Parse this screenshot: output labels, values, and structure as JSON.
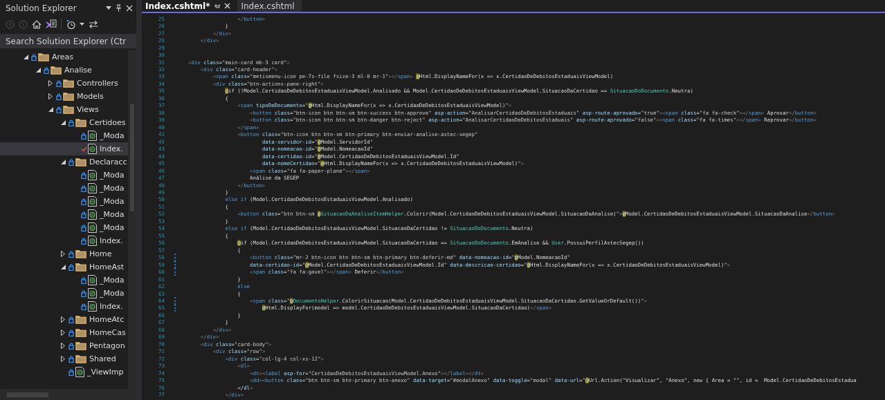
{
  "solution_explorer": {
    "title": "Solution Explorer",
    "search": {
      "placeholder": "Search Solution Explorer (Ctr"
    },
    "tree": [
      {
        "label": "Areas",
        "kind": "folder",
        "expanded": true,
        "selected": false,
        "pending_edit": false,
        "children": [
          {
            "label": "Analise",
            "kind": "folder",
            "expanded": true,
            "selected": false,
            "pending_edit": false,
            "children": [
              {
                "label": "Controllers",
                "kind": "folder",
                "expanded": false,
                "selected": false,
                "pending_edit": false
              },
              {
                "label": "Models",
                "kind": "folder",
                "expanded": false,
                "selected": false,
                "pending_edit": false
              },
              {
                "label": "Views",
                "kind": "folder",
                "expanded": true,
                "selected": false,
                "pending_edit": false,
                "children": [
                  {
                    "label": "Certidoes",
                    "kind": "folder",
                    "expanded": true,
                    "selected": false,
                    "pending_edit": false,
                    "children": [
                      {
                        "label": "_Moda",
                        "kind": "file",
                        "selected": false,
                        "pending_edit": false
                      },
                      {
                        "label": "Index.",
                        "kind": "file",
                        "selected": true,
                        "pending_edit": true
                      }
                    ]
                  },
                  {
                    "label": "Declaracc",
                    "kind": "folder",
                    "expanded": true,
                    "selected": false,
                    "pending_edit": false,
                    "children": [
                      {
                        "label": "_Moda",
                        "kind": "file",
                        "selected": false,
                        "pending_edit": false
                      },
                      {
                        "label": "_Moda",
                        "kind": "file",
                        "selected": false,
                        "pending_edit": false
                      },
                      {
                        "label": "_Moda",
                        "kind": "file",
                        "selected": false,
                        "pending_edit": false
                      },
                      {
                        "label": "_Moda",
                        "kind": "file",
                        "selected": false,
                        "pending_edit": false
                      },
                      {
                        "label": "_Moda",
                        "kind": "file",
                        "selected": false,
                        "pending_edit": false
                      },
                      {
                        "label": "Index.",
                        "kind": "file",
                        "selected": false,
                        "pending_edit": false
                      }
                    ]
                  },
                  {
                    "label": "Home",
                    "kind": "folder",
                    "expanded": false,
                    "selected": false,
                    "pending_edit": false
                  },
                  {
                    "label": "HomeAst",
                    "kind": "folder",
                    "expanded": true,
                    "selected": false,
                    "pending_edit": false,
                    "children": [
                      {
                        "label": "_Moda",
                        "kind": "file",
                        "selected": false,
                        "pending_edit": false
                      },
                      {
                        "label": "_Moda",
                        "kind": "file",
                        "selected": false,
                        "pending_edit": false
                      },
                      {
                        "label": "Index.",
                        "kind": "file",
                        "selected": false,
                        "pending_edit": false
                      }
                    ]
                  },
                  {
                    "label": "HomeAtc",
                    "kind": "folder",
                    "expanded": false,
                    "selected": false,
                    "pending_edit": false
                  },
                  {
                    "label": "HomeCas",
                    "kind": "folder",
                    "expanded": false,
                    "selected": false,
                    "pending_edit": false
                  },
                  {
                    "label": "Pentagon",
                    "kind": "folder",
                    "expanded": false,
                    "selected": false,
                    "pending_edit": false
                  },
                  {
                    "label": "Shared",
                    "kind": "folder",
                    "expanded": false,
                    "selected": false,
                    "pending_edit": false
                  },
                  {
                    "label": "_ViewImp",
                    "kind": "file",
                    "selected": false,
                    "pending_edit": false
                  }
                ]
              }
            ]
          }
        ]
      }
    ]
  },
  "editor": {
    "tabs": [
      {
        "label": "Index.cshtml*",
        "selected": true
      },
      {
        "label": "Index.cshtml",
        "selected": false
      }
    ],
    "lines": [
      {
        "n": "25",
        "text": "                </button>",
        "modified": false
      },
      {
        "n": "26",
        "text": "            }",
        "modified": false
      },
      {
        "n": "27",
        "text": "        </div>",
        "modified": false
      },
      {
        "n": "28",
        "text": "    </div>",
        "modified": false
      },
      {
        "n": "29",
        "modified": false
      },
      {
        "n": "30",
        "modified": false
      },
      {
        "n": "31",
        "text": "<div class=\"main-card mb-3 card\">",
        "modified": false
      },
      {
        "n": "32",
        "text": "    <div class=\"card-header\">",
        "modified": false
      },
      {
        "n": "33",
        "text": "        <span class=\"metismenu-icon pe-7s-file fsize-3 ml-0 mr-1\"></span> @Html.DisplayNameFor(x => x.CertidaoDeDebitosEstaduaisViewModel)",
        "modified": false
      },
      {
        "n": "34",
        "text": "        <div class=\"btn-actions-pane-right\">",
        "modified": false
      },
      {
        "n": "35",
        "text": "            @if (!Model.CertidaoDeDebitosEstaduaisViewModel.Analisado && Model.CertidaoDeDebitosEstaduaisViewModel.SituacaoDaCertidao == SituacaoDoDocumento.Neutra)",
        "modified": false
      },
      {
        "n": "36",
        "text": "            {",
        "modified": false
      },
      {
        "n": "37",
        "text": "                <span tipoDeDocumento=\"@Html.DisplayNameFor(x => x.CertidaoDeDebitosEstaduaisViewModel)\">",
        "modified": false
      },
      {
        "n": "38",
        "text": "                    <button class=\"btn-icon btn btn-sm btn-success btn-approve\" asp-action=\"AnalisarCertidaoDeDebitosEstaduais\" asp-route-aprovado=\"true\"><span class=\"fa fa-check\"></span> Aprovar</button>",
        "modified": false
      },
      {
        "n": "39",
        "text": "                    <button class=\"btn-icon btn btn-sm btn-danger btn-reject\" asp-action=\"AnalisarCertidaoDeDebitosEstaduais\" asp-route-aprovado=\"false\"><span class=\"fa fa-times\"></span> Reprovar</button>",
        "modified": false
      },
      {
        "n": "40",
        "text": "                </span>",
        "modified": false
      },
      {
        "n": "41",
        "text": "                <button class=\"btn-icon btn btn-sm btn-primary btn-enviar-analise-astec-segep\"",
        "modified": false
      },
      {
        "n": "42",
        "text": "                        data-servidor-id=\"@Model.ServidorId\"",
        "modified": false
      },
      {
        "n": "43",
        "text": "                        data-nomeacao-id=\"@Model.NomeacaoId\"",
        "modified": false
      },
      {
        "n": "44",
        "text": "                        data-certidao-id=\"@Model.CertidaoDeDebitosEstaduaisViewModel.Id\"",
        "modified": false
      },
      {
        "n": "45",
        "text": "                        data-nomeCertidao=\"@Html.DisplayNameFor(x => x.CertidaoDeDebitosEstaduaisViewModel)\">",
        "modified": false
      },
      {
        "n": "46",
        "text": "                    <span class=\"fa fa-paper-plane\"></span>",
        "modified": false
      },
      {
        "n": "47",
        "text": "                    Análise da SEGEP",
        "modified": false
      },
      {
        "n": "48",
        "text": "                </button>",
        "modified": false
      },
      {
        "n": "49",
        "text": "            }",
        "modified": false
      },
      {
        "n": "50",
        "text": "            else if (Model.CertidaoDeDebitosEstaduaisViewModel.Analisado)",
        "modified": false
      },
      {
        "n": "51",
        "text": "            {",
        "modified": false
      },
      {
        "n": "52",
        "text": "                <button class=\"btn btn-sm @SituacaoDaAnaliseItemHelper.Colorir(Model.CertidaoDeDebitosEstaduaisViewModel.SituacaoDaAnalise)\">@Model.CertidaoDeDebitosEstaduaisViewModel.SituacaoDaAnalise</button>",
        "modified": false
      },
      {
        "n": "53",
        "text": "            }",
        "modified": false
      },
      {
        "n": "54",
        "text": "            else if (Model.CertidaoDeDebitosEstaduaisViewModel.SituacaoDaCertidao != SituacaoDoDocumento.Neutra)",
        "modified": false
      },
      {
        "n": "55",
        "text": "            {",
        "modified": false
      },
      {
        "n": "56",
        "text": "                @if (Model.CertidaoDeDebitosEstaduaisViewModel.SituacaoDaCertidao == SituacaoDoDocumento.EmAnalise && User.PossuiPerfilAstecSegep())",
        "modified": false
      },
      {
        "n": "57",
        "text": "                {",
        "modified": false
      },
      {
        "n": "58",
        "text": "                    <button class=\"mr-2 btn-icon btn btn-sm btn-primary btn-deferir-md\" data-nomeacao-id=\"@Model.NomeacaoId\"",
        "modified": true
      },
      {
        "n": "59",
        "text": "                    data-certidao-id=\"@Model.CertidaoDeDebitosEstaduaisViewModel.Id\" data-descricao-certidao=\"@Html.DisplayNameFor(x => x.CertidaoDeDebitosEstaduaisViewModel)\">",
        "modified": true
      },
      {
        "n": "60",
        "text": "                    <span class=\"fa fa-gavel\"></span> Deferir</button>",
        "modified": true
      },
      {
        "n": "61",
        "text": "                }",
        "modified": false
      },
      {
        "n": "62",
        "text": "                else",
        "modified": false
      },
      {
        "n": "63",
        "text": "                {",
        "modified": false
      },
      {
        "n": "64",
        "text": "                    <span class=\"@DocumentoHelper.ColorirSituacao(Model.CertidaoDeDebitosEstaduaisViewModel.SituacaoDaCertidao.GetValueOrDefault())\">",
        "modified": true
      },
      {
        "n": "65",
        "text": "                        @Html.DisplayFor(model => model.CertidaoDeDebitosEstaduaisViewModel.SituacaoDaCertidao)</span>",
        "modified": true
      },
      {
        "n": "66",
        "text": "                }",
        "modified": false
      },
      {
        "n": "67",
        "text": "            }",
        "modified": false
      },
      {
        "n": "68",
        "text": "        </div>",
        "modified": false
      },
      {
        "n": "69",
        "text": "    </div>",
        "modified": false
      },
      {
        "n": "70",
        "text": "    <div class=\"card-body\">",
        "modified": false
      },
      {
        "n": "71",
        "text": "        <div class=\"row\">",
        "modified": false
      },
      {
        "n": "72",
        "text": "            <div class=\"col-lg-4 col-xs-12\">",
        "modified": false
      },
      {
        "n": "73",
        "text": "                <dl>",
        "modified": false
      },
      {
        "n": "74",
        "text": "                    <dt><label asp-for=\"CertidaoDeDebitosEstaduaisViewModel.Anexo\"></label></dt>",
        "modified": false
      },
      {
        "n": "75",
        "text": "                    <dd><button class=\"btn btn-sm btn-primary btn-anexo\" data-target=\"#modalAnexo\" data-toggle=\"modal\" data-url=\"@Url.Action(\"Visualizar\", \"Anexo\", new { Area = \"\", id =  Model.CertidaoDeDebitosEstadua",
        "modified": false
      },
      {
        "n": "76",
        "text": "                </dl>",
        "modified": false
      },
      {
        "n": "77",
        "text": "            </div>",
        "modified": false
      }
    ]
  }
}
